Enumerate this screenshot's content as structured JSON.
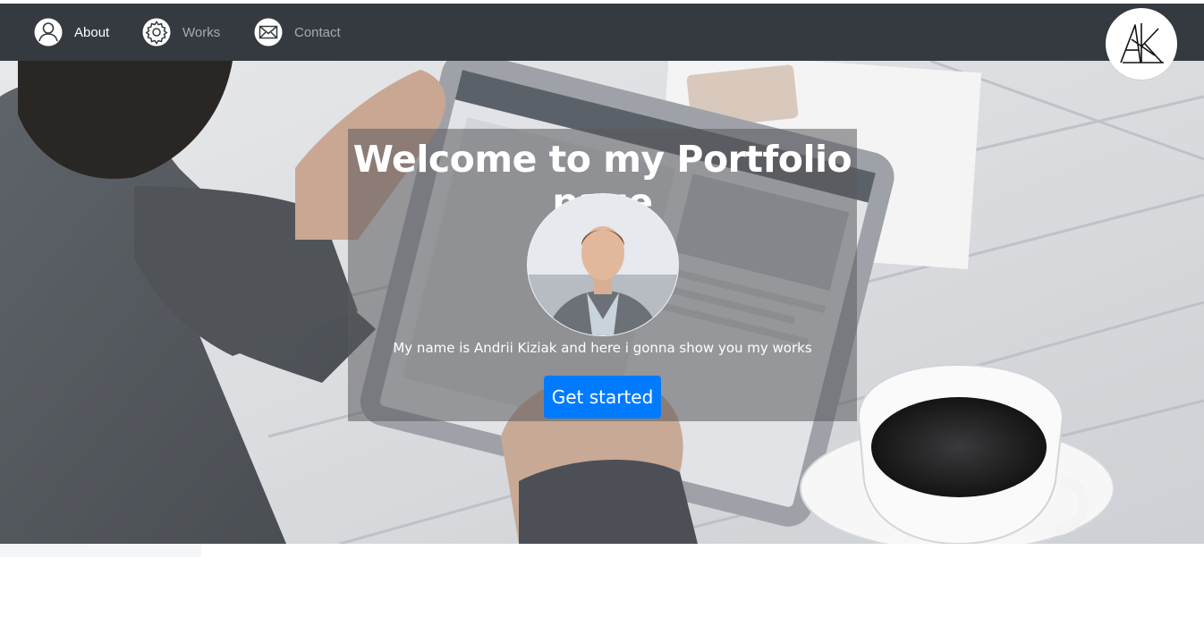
{
  "nav": {
    "items": [
      {
        "label": "About",
        "icon": "user-icon",
        "active": true
      },
      {
        "label": "Works",
        "icon": "gear-icon",
        "active": false
      },
      {
        "label": "Contact",
        "icon": "envelope-icon",
        "active": false
      }
    ],
    "logo_icon": "ak-monogram-logo"
  },
  "hero": {
    "title": "Welcome to my Portfolio page",
    "tagline": "My name is Andrii Kiziak and here i gonna show you my works",
    "cta_label": "Get started",
    "avatar_icon": "profile-photo"
  },
  "colors": {
    "navbar": "#343a40",
    "cta": "#007bff",
    "nav_text": "#a7abb0",
    "nav_text_active": "#ffffff"
  }
}
